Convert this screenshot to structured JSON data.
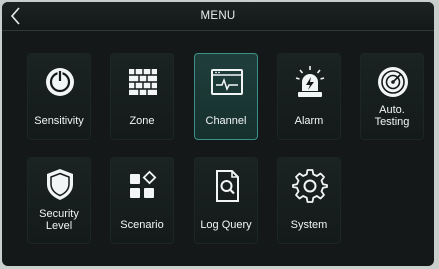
{
  "header": {
    "title": "MENU"
  },
  "tiles": [
    {
      "label": "Sensitivity",
      "icon": "power-icon"
    },
    {
      "label": "Zone",
      "icon": "fence-icon"
    },
    {
      "label": "Channel",
      "icon": "waveform-window-icon",
      "active": true
    },
    {
      "label": "Alarm",
      "icon": "siren-icon"
    },
    {
      "label_line1": "Auto.",
      "label_line2": "Testing",
      "icon": "radar-target-icon"
    },
    {
      "label_line1": "Security",
      "label_line2": "Level",
      "icon": "shield-icon"
    },
    {
      "label": "Scenario",
      "icon": "shapes-icon"
    },
    {
      "label": "Log Query",
      "icon": "document-search-icon"
    },
    {
      "label": "System",
      "icon": "gear-icon"
    }
  ],
  "colors": {
    "accent": "#3b8f86",
    "background": "#141818",
    "text": "#f2f5f5"
  }
}
